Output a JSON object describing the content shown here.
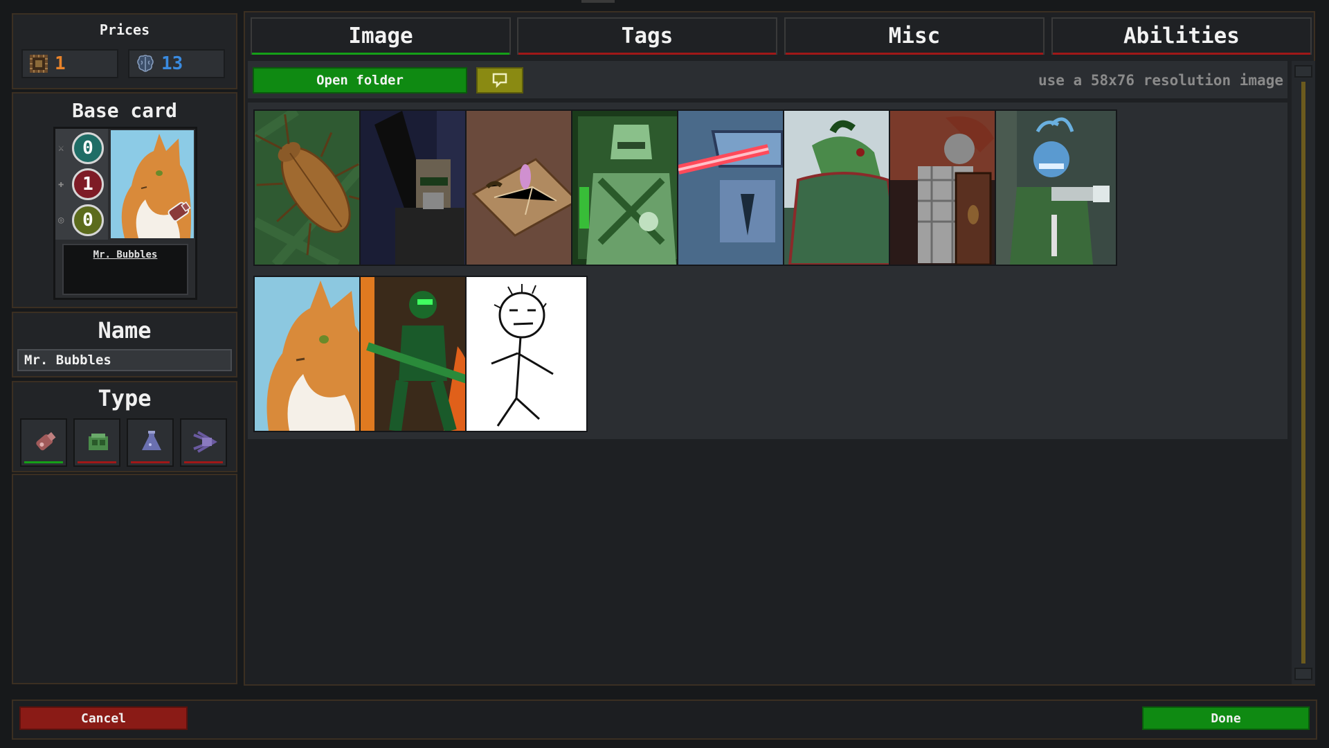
{
  "prices": {
    "title": "Prices",
    "items": [
      {
        "icon": "bone-chip-icon",
        "value": "1",
        "color": "#e8832a"
      },
      {
        "icon": "brain-icon",
        "value": "13",
        "color": "#3a8be0"
      }
    ]
  },
  "base_card": {
    "title": "Base card",
    "stats": [
      {
        "symbol": "⚔",
        "value": "0",
        "color": "#1f6d66"
      },
      {
        "symbol": "✚",
        "value": "1",
        "color": "#7e1b26"
      },
      {
        "symbol": "◎",
        "value": "0",
        "color": "#5c6b1d"
      }
    ],
    "card_name": "Mr. Bubbles",
    "art": "cat-portrait"
  },
  "name": {
    "title": "Name",
    "value": "Mr. Bubbles"
  },
  "type": {
    "title": "Type",
    "options": [
      {
        "icon": "flesh-icon",
        "selected": true
      },
      {
        "icon": "mech-icon",
        "selected": false
      },
      {
        "icon": "magic-icon",
        "selected": false
      },
      {
        "icon": "beast-icon",
        "selected": false
      }
    ]
  },
  "tabs": [
    {
      "label": "Image",
      "active": true
    },
    {
      "label": "Tags",
      "active": false
    },
    {
      "label": "Misc",
      "active": false
    },
    {
      "label": "Abilities",
      "active": false
    }
  ],
  "toolbar": {
    "open_folder": "Open folder",
    "help_icon": "speech-bubble-icon",
    "hint": "use a 58x76 resolution image"
  },
  "images": [
    {
      "name": "cockroach",
      "bg": "#2f5a32"
    },
    {
      "name": "armored-soldier",
      "bg": "#1a1d35"
    },
    {
      "name": "parchment-map",
      "bg": "#6a4a3c"
    },
    {
      "name": "green-knight",
      "bg": "#2d5a2d"
    },
    {
      "name": "laser-robot",
      "bg": "#4a6a8a"
    },
    {
      "name": "crocodile-man",
      "bg": "#3a5a48"
    },
    {
      "name": "shield-warrior",
      "bg": "#7a3a2a"
    },
    {
      "name": "blue-alien-gunner",
      "bg": "#3a4a44"
    },
    {
      "name": "cat-portrait",
      "bg": "#8cc8e0"
    },
    {
      "name": "green-armored-soldier",
      "bg": "#3a2a1a"
    },
    {
      "name": "stick-figure",
      "bg": "#ffffff"
    }
  ],
  "buttons": {
    "cancel": "Cancel",
    "done": "Done"
  }
}
